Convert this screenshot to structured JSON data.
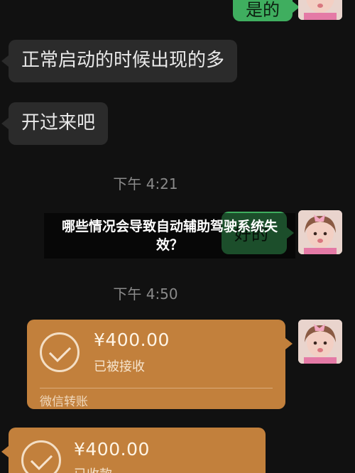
{
  "chat": {
    "msg_top_right": "是的",
    "msg_left_1": "正常启动的时候出现的多",
    "msg_left_2": "开过来吧",
    "time_1": "下午 4:21",
    "msg_mid_right": "好的",
    "time_2": "下午 4:50"
  },
  "overlay": {
    "title": "哪些情况会导致自动辅助驾驶系统失效？"
  },
  "transfers": [
    {
      "amount": "¥400.00",
      "status": "已被接收",
      "footer": "微信转账"
    },
    {
      "amount": "¥400.00",
      "status": "已收款"
    }
  ],
  "colors": {
    "background": "#111111",
    "bubble_left": "#2b2b2b",
    "bubble_right": "#3fae5f",
    "transfer": "#c2803c"
  },
  "icons": {
    "transfer_check": "check-circle-icon",
    "avatar": "avatar-icon"
  }
}
